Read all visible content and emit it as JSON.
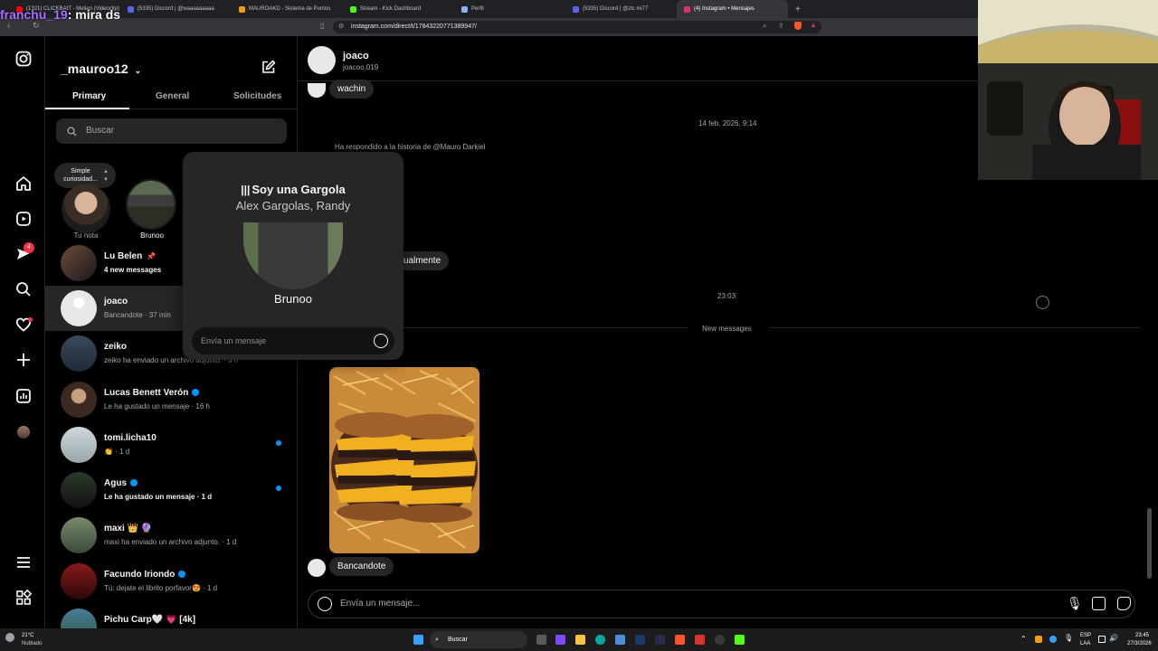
{
  "browser": {
    "tabs": [
      {
        "label": "(1321) CLICKBAIT - Melian (Videoclip)",
        "color": "#ff0000"
      },
      {
        "label": "(5335) Discord | @waaaaaaaaa",
        "color": "#5865f2"
      },
      {
        "label": "MAUROAKD - Sistema de Puntos",
        "color": "#f59e0b"
      },
      {
        "label": "Stream - Kick Dashboard",
        "color": "#53fc18"
      },
      {
        "label": "Perfil",
        "color": "#8ab4f8"
      },
      {
        "label": "(5335) Discord | @zlc #x77",
        "color": "#5865f2"
      },
      {
        "label": "(4) Instagram • Mensajes",
        "color": "#e1306c",
        "active": true
      }
    ],
    "url": "instagram.com/direct/t/17843220771389947/"
  },
  "stream_chat": {
    "user": "franchu_19",
    "message": "mira ds"
  },
  "inbox": {
    "username": "_mauroo12",
    "tabs": [
      "Primary",
      "General",
      "Solicitudes"
    ],
    "search_placeholder": "Buscar",
    "note_bubble": "Simple curiosidad...",
    "notes": [
      {
        "label": "Tu nota"
      },
      {
        "label": "Brunoo"
      }
    ],
    "conversations": [
      {
        "name": "Lu Belen",
        "sub": "4 new messages",
        "bold": true,
        "pinned": true
      },
      {
        "name": "joaco",
        "sub": "Bancandote · 37 min",
        "selected": true
      },
      {
        "name": "zeiko",
        "sub": "zeiko ha enviado un archivo adjunto. · 3 h"
      },
      {
        "name": "Lucas Benett Verón",
        "sub": "Le ha gustado un mensaje · 16 h",
        "verified": true
      },
      {
        "name": "tomi.licha10",
        "sub": "👏 · 1 d",
        "unread": true
      },
      {
        "name": "Agus",
        "sub": "Le ha gustado un mensaje · 1 d",
        "verified": true,
        "bold": true,
        "unread": true
      },
      {
        "name": "maxi 👑 🔮",
        "sub": "maxi ha enviado un archivo adjunto. · 1 d"
      },
      {
        "name": "Facundo Iriondo",
        "sub": "Tú: dejate el librito porfavor😍 · 1 d",
        "verified": true
      },
      {
        "name": "Pichu Carp🤍 💗 [4k]",
        "sub": ""
      }
    ],
    "unread_badge": "4"
  },
  "chat": {
    "name": "joaco",
    "handle": "joacoo.019",
    "msg_top": "wachin",
    "date1": "14 feb. 2026, 9:14",
    "story_reply": "Ha respondido a la historia de @Mauro Darkiel",
    "msg_partial": "ualmente",
    "time2": "23:03",
    "new_messages": "New messages",
    "msg_last": "Bancandote",
    "input_placeholder": "Envía un mensaje..."
  },
  "note_popup": {
    "song": "Soy una Gargola",
    "artist": "Alex Gargolas, Randy",
    "name": "Brunoo",
    "input_placeholder": "Envía un mensaje"
  },
  "taskbar": {
    "weather_temp": "21°C",
    "weather_desc": "Nublado",
    "search": "Buscar",
    "lang1": "ESP",
    "lang2": "LAA",
    "time": "23:45",
    "date": "27/3/2026"
  }
}
